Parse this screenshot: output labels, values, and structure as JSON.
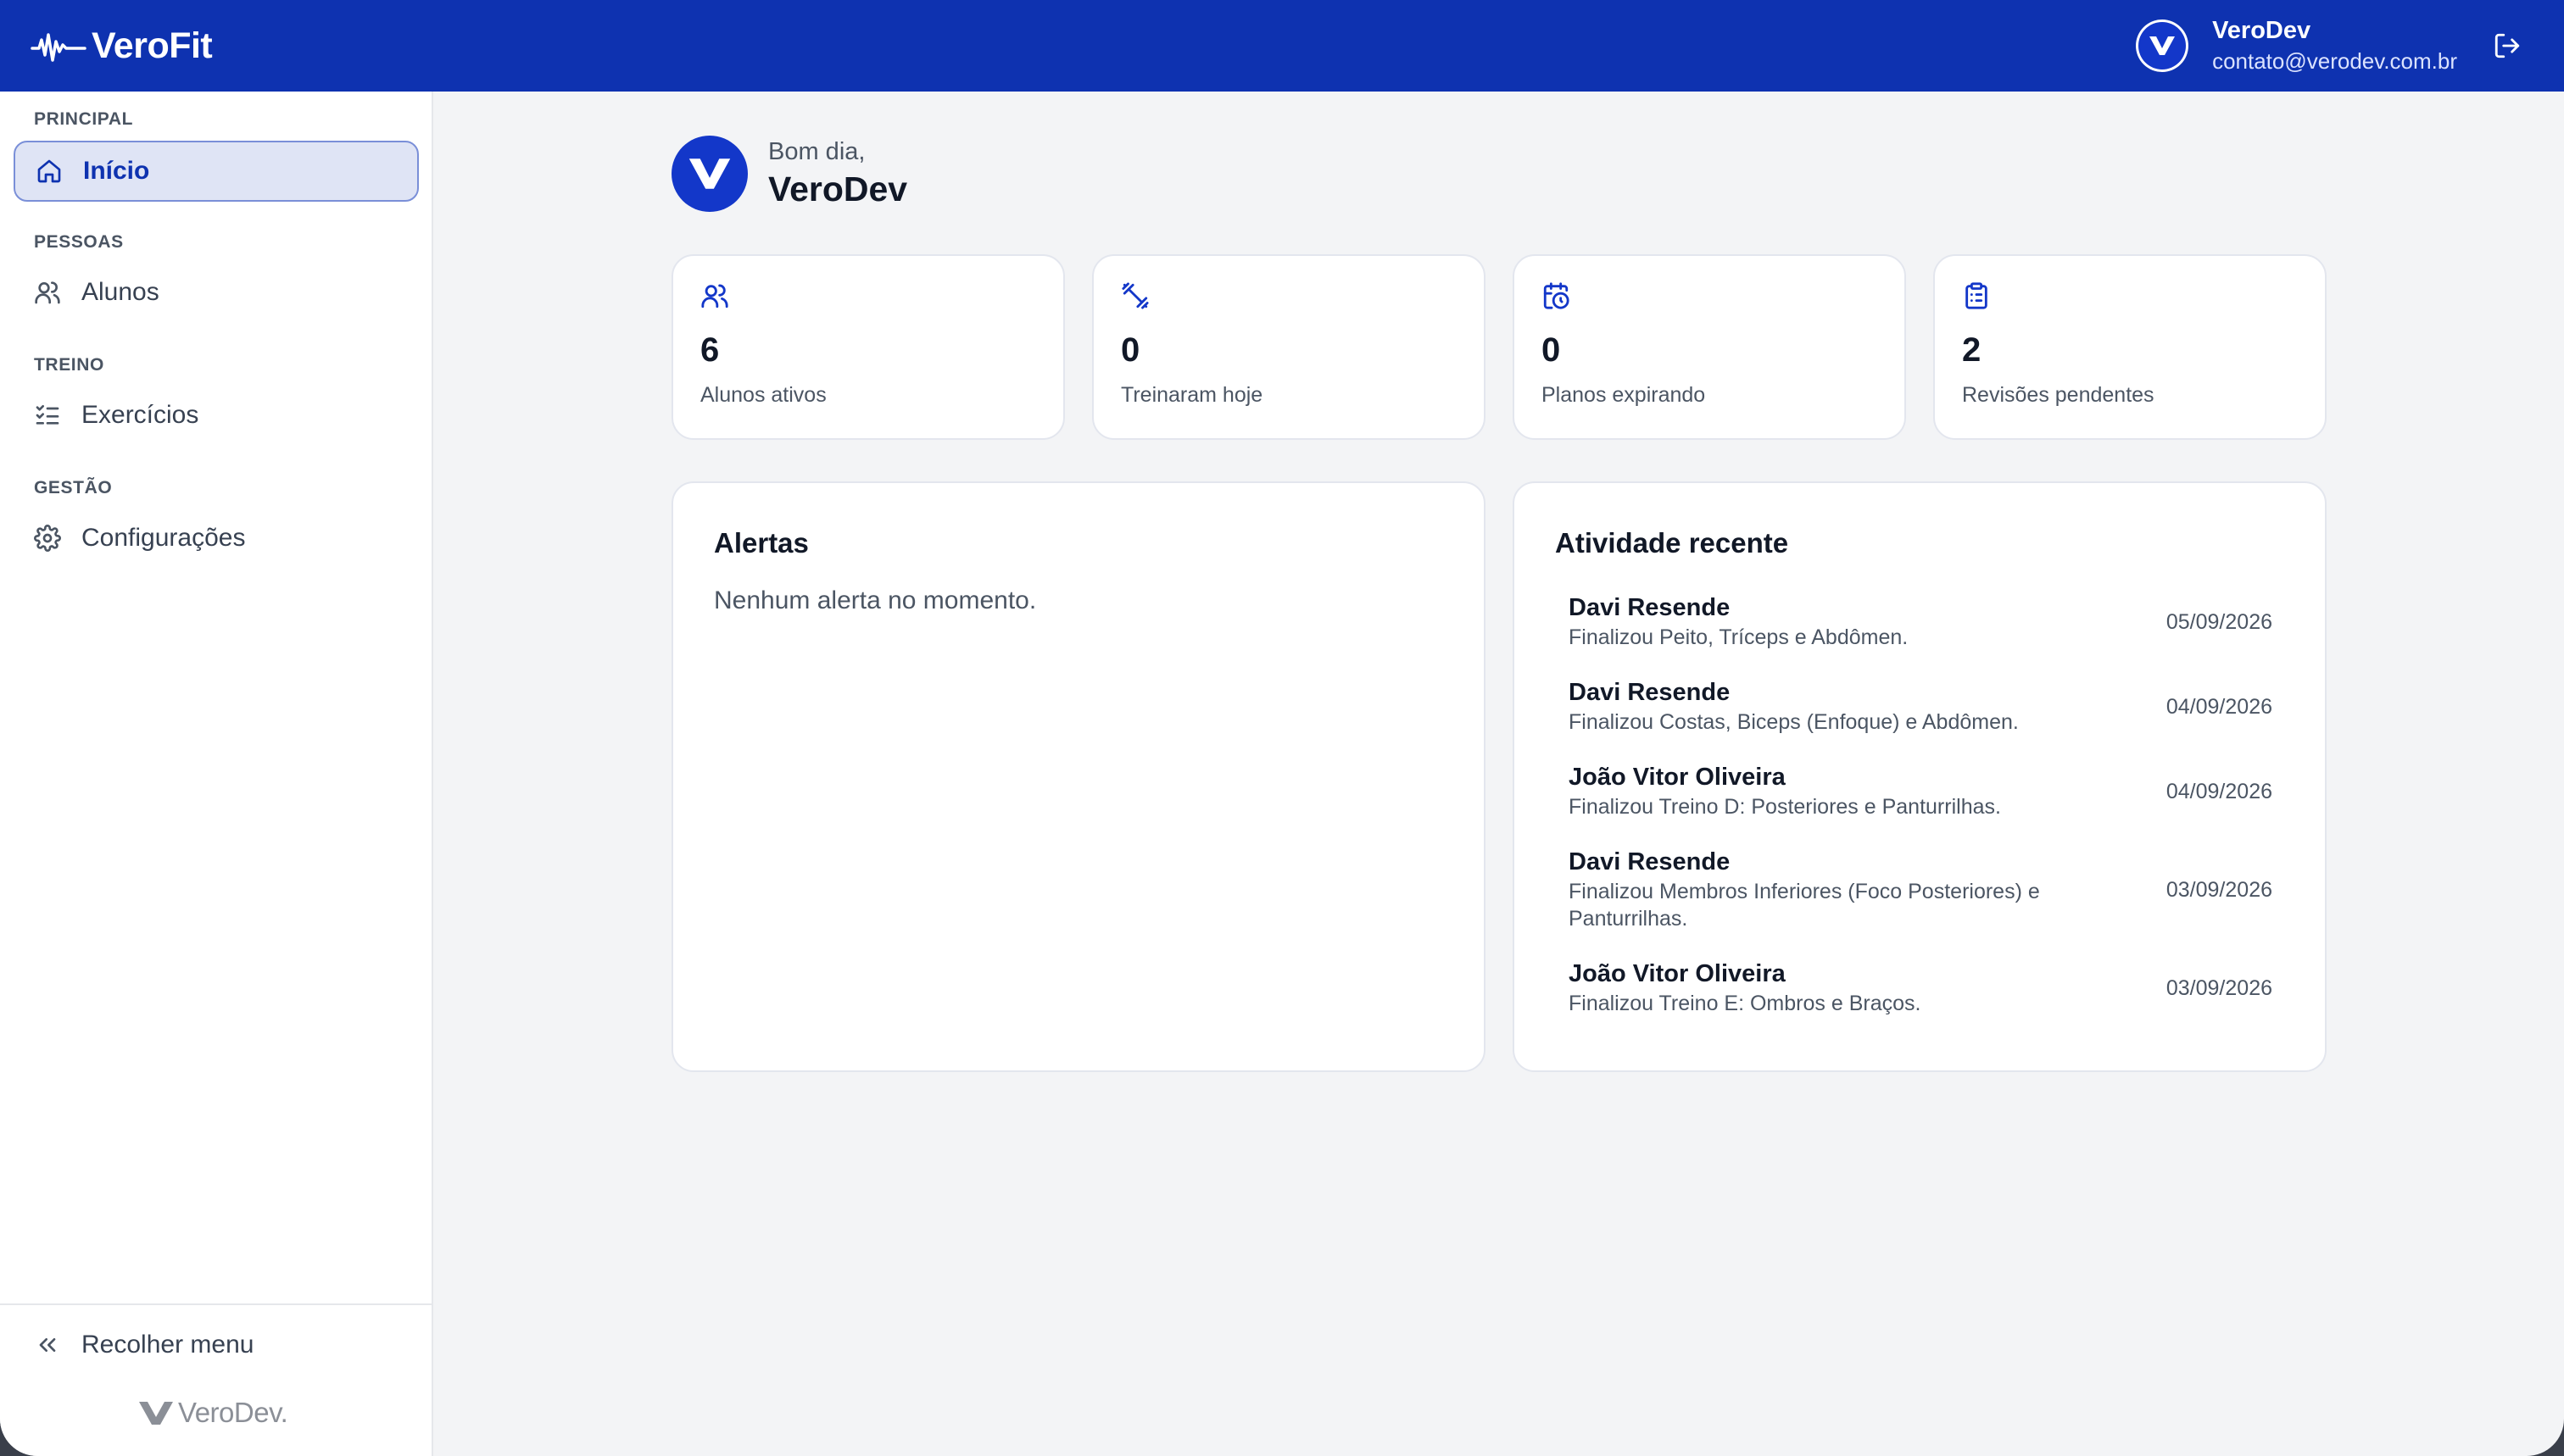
{
  "brand": {
    "name": "VeroFit"
  },
  "user": {
    "name": "VeroDev",
    "email": "contato@verodev.com.br"
  },
  "sidebar": {
    "sections": [
      {
        "label": "PRINCIPAL",
        "item": "Início",
        "icon": "home-icon",
        "active": true
      },
      {
        "label": "PESSOAS",
        "item": "Alunos",
        "icon": "users-icon",
        "active": false
      },
      {
        "label": "TREINO",
        "item": "Exercícios",
        "icon": "checklist-icon",
        "active": false
      },
      {
        "label": "GESTÃO",
        "item": "Configurações",
        "icon": "gear-icon",
        "active": false
      }
    ],
    "collapse_label": "Recolher menu",
    "footer_logo": "VeroDev."
  },
  "greeting": {
    "hello": "Bom dia,",
    "name": "VeroDev"
  },
  "stats": [
    {
      "value": "6",
      "label": "Alunos ativos",
      "icon": "users-icon"
    },
    {
      "value": "0",
      "label": "Treinaram hoje",
      "icon": "dumbbell-icon"
    },
    {
      "value": "0",
      "label": "Planos expirando",
      "icon": "calendar-clock-icon"
    },
    {
      "value": "2",
      "label": "Revisões pendentes",
      "icon": "clipboard-icon"
    }
  ],
  "alerts": {
    "title": "Alertas",
    "empty": "Nenhum alerta no momento."
  },
  "activity": {
    "title": "Atividade recente",
    "items": [
      {
        "name": "Davi Resende",
        "desc": "Finalizou Peito, Tríceps e Abdômen.",
        "date": "05/09/2026"
      },
      {
        "name": "Davi Resende",
        "desc": "Finalizou Costas, Biceps (Enfoque) e Abdômen.",
        "date": "04/09/2026"
      },
      {
        "name": "João Vitor Oliveira",
        "desc": "Finalizou Treino D: Posteriores e Panturrilhas.",
        "date": "04/09/2026"
      },
      {
        "name": "Davi Resende",
        "desc": "Finalizou Membros Inferiores (Foco Posteriores) e Panturrilhas.",
        "date": "03/09/2026"
      },
      {
        "name": "João Vitor Oliveira",
        "desc": "Finalizou Treino E: Ombros e Braços.",
        "date": "03/09/2026"
      }
    ]
  },
  "colors": {
    "primary": "#0e32b0",
    "accent": "#1337c9",
    "background": "#f3f4f6"
  }
}
